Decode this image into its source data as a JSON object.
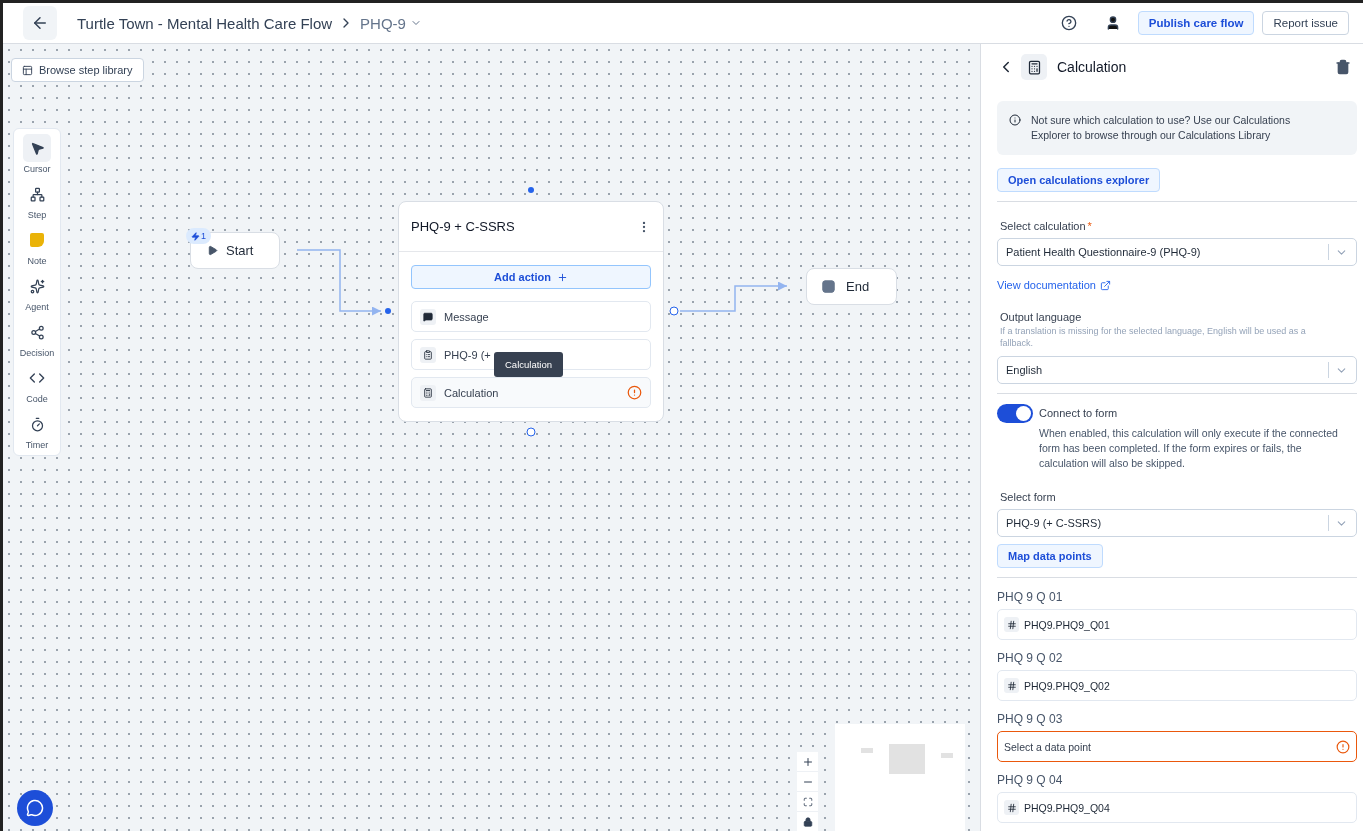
{
  "header": {
    "title": "Turtle Town - Mental Health Care Flow",
    "current": "PHQ-9",
    "buttons": [
      {
        "label": "Publish care flow",
        "kind": "primary"
      },
      {
        "label": "Report issue",
        "kind": "secondary"
      }
    ]
  },
  "canvas": {
    "library_button": "Browse step library",
    "tools": [
      {
        "kind": "cursor",
        "label": "Cursor",
        "selected": true
      },
      {
        "kind": "step",
        "label": "Step",
        "selected": false
      },
      {
        "kind": "note",
        "label": "Note",
        "selected": false
      },
      {
        "kind": "agent",
        "label": "Agent",
        "selected": false
      },
      {
        "kind": "decision",
        "label": "Decision",
        "selected": false
      },
      {
        "kind": "code",
        "label": "Code",
        "selected": false
      },
      {
        "kind": "timer",
        "label": "Timer",
        "selected": false
      }
    ],
    "start": {
      "label": "Start",
      "badge": "1"
    },
    "step": {
      "title": "PHQ-9 + C-SSRS",
      "add_action": "Add action",
      "actions": [
        {
          "kind": "message",
          "label": "Message",
          "warning": false
        },
        {
          "kind": "form",
          "label": "PHQ-9 (+",
          "warning": false
        },
        {
          "kind": "calculation",
          "label": "Calculation",
          "warning": true
        }
      ],
      "tooltip": "Calculation"
    },
    "end": {
      "label": "End"
    }
  },
  "panel": {
    "title": "Calculation",
    "info": "Not sure which calculation to use? Use our Calculations Explorer to browse through our Calculations Library",
    "explorer_button": "Open calculations explorer",
    "calculation": {
      "label": "Select calculation",
      "required_mark": "*",
      "value": "Patient Health Questionnaire-9 (PHQ-9)"
    },
    "doc_link": "View documentation",
    "language": {
      "label": "Output language",
      "hint": "If a translation is missing for the selected language, English will be used as a fallback.",
      "value": "English"
    },
    "connect": {
      "label": "Connect to form",
      "on": true,
      "description": "When enabled, this calculation will only execute if the connected form has been completed. If the form expires or fails, the calculation will also be skipped."
    },
    "form": {
      "label": "Select form",
      "value": "PHQ-9 (+ C-SSRS)"
    },
    "map_button": "Map data points",
    "mappings": [
      {
        "label": "PHQ 9 Q 01",
        "value": "PHQ9.PHQ9_Q01",
        "error": false
      },
      {
        "label": "PHQ 9 Q 02",
        "value": "PHQ9.PHQ9_Q02",
        "error": false
      },
      {
        "label": "PHQ 9 Q 03",
        "placeholder": "Select a data point",
        "error": true
      },
      {
        "label": "PHQ 9 Q 04",
        "value": "PHQ9.PHQ9_Q04",
        "error": false
      }
    ]
  }
}
